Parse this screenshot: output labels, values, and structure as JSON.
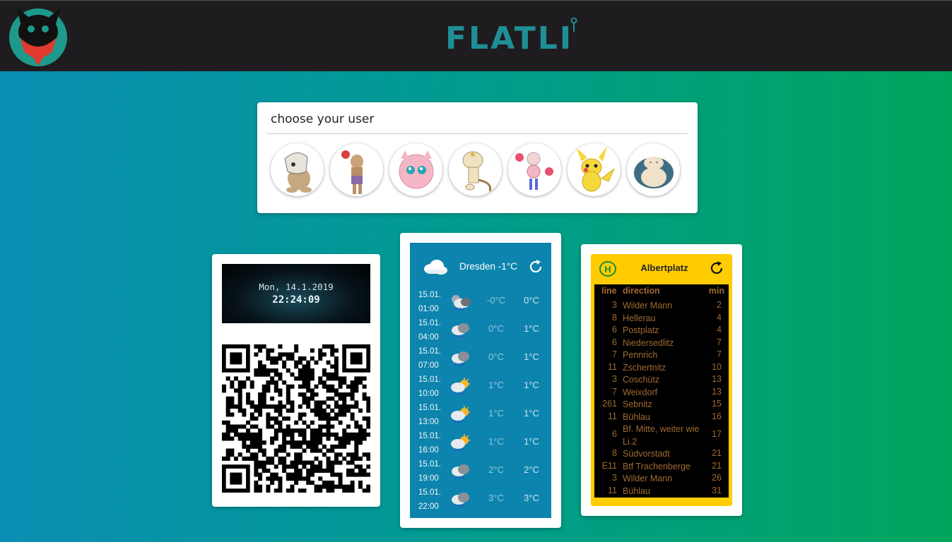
{
  "app": {
    "brand": "FLATLI",
    "logo_icon": "cat-bandana-logo-icon"
  },
  "user_chooser": {
    "title": "choose your user",
    "users": [
      {
        "name": "cubone",
        "color": "#c9b99a"
      },
      {
        "name": "hitmonchan",
        "color": "#b08e6b"
      },
      {
        "name": "jigglypuff",
        "color": "#f5b6c8"
      },
      {
        "name": "meowth",
        "color": "#efe2bf"
      },
      {
        "name": "mr-mime",
        "color": "#f2b7c7"
      },
      {
        "name": "pikachu",
        "color": "#f5d83c"
      },
      {
        "name": "snorlax",
        "color": "#3e6e82"
      }
    ]
  },
  "clock": {
    "date": "Mon, 14.1.2019",
    "time": "22:24:09"
  },
  "qr": {
    "icon": "qr-code-icon"
  },
  "weather": {
    "city": "Dresden -1°C",
    "header_icon": "cloud-icon",
    "refresh_icon": "refresh-icon",
    "rows": [
      {
        "date": "15.01.",
        "time": "01:00",
        "icon": "cloud-night-icon",
        "min": "-0°C",
        "max": "0°C"
      },
      {
        "date": "15.01.",
        "time": "04:00",
        "icon": "cloud-rain-icon",
        "min": "0°C",
        "max": "1°C"
      },
      {
        "date": "15.01.",
        "time": "07:00",
        "icon": "cloud-rain-icon",
        "min": "0°C",
        "max": "1°C"
      },
      {
        "date": "15.01.",
        "time": "10:00",
        "icon": "sun-cloud-rain-icon",
        "min": "1°C",
        "max": "1°C"
      },
      {
        "date": "15.01.",
        "time": "13:00",
        "icon": "sun-cloud-rain-icon",
        "min": "1°C",
        "max": "1°C"
      },
      {
        "date": "15.01.",
        "time": "16:00",
        "icon": "sun-cloud-rain-icon",
        "min": "1°C",
        "max": "1°C"
      },
      {
        "date": "15.01.",
        "time": "19:00",
        "icon": "cloud-rain-icon",
        "min": "2°C",
        "max": "2°C"
      },
      {
        "date": "15.01.",
        "time": "22:00",
        "icon": "cloud-rain-icon",
        "min": "3°C",
        "max": "3°C"
      }
    ]
  },
  "transit": {
    "stop": "Albertplatz",
    "stop_icon": "bus-stop-h-icon",
    "refresh_icon": "refresh-icon",
    "headers": {
      "line": "line",
      "direction": "direction",
      "min": "min"
    },
    "departures": [
      {
        "line": "3",
        "direction": "Wilder Mann",
        "min": "2"
      },
      {
        "line": "8",
        "direction": "Hellerau",
        "min": "4"
      },
      {
        "line": "6",
        "direction": "Postplatz",
        "min": "4"
      },
      {
        "line": "6",
        "direction": "Niedersedlitz",
        "min": "7"
      },
      {
        "line": "7",
        "direction": "Pennrich",
        "min": "7"
      },
      {
        "line": "11",
        "direction": "Zschertnitz",
        "min": "10"
      },
      {
        "line": "3",
        "direction": "Coschütz",
        "min": "13"
      },
      {
        "line": "7",
        "direction": "Weixdorf",
        "min": "13"
      },
      {
        "line": "261",
        "direction": "Sebnitz",
        "min": "15"
      },
      {
        "line": "11",
        "direction": "Bühlau",
        "min": "16"
      },
      {
        "line": "6",
        "direction": "Bf. Mitte, weiter wie Li.2",
        "min": "17"
      },
      {
        "line": "8",
        "direction": "Südvorstadt",
        "min": "21"
      },
      {
        "line": "E11",
        "direction": "Btf Trachenberge",
        "min": "21"
      },
      {
        "line": "3",
        "direction": "Wilder Mann",
        "min": "26"
      },
      {
        "line": "11",
        "direction": "Bühlau",
        "min": "31"
      }
    ]
  }
}
